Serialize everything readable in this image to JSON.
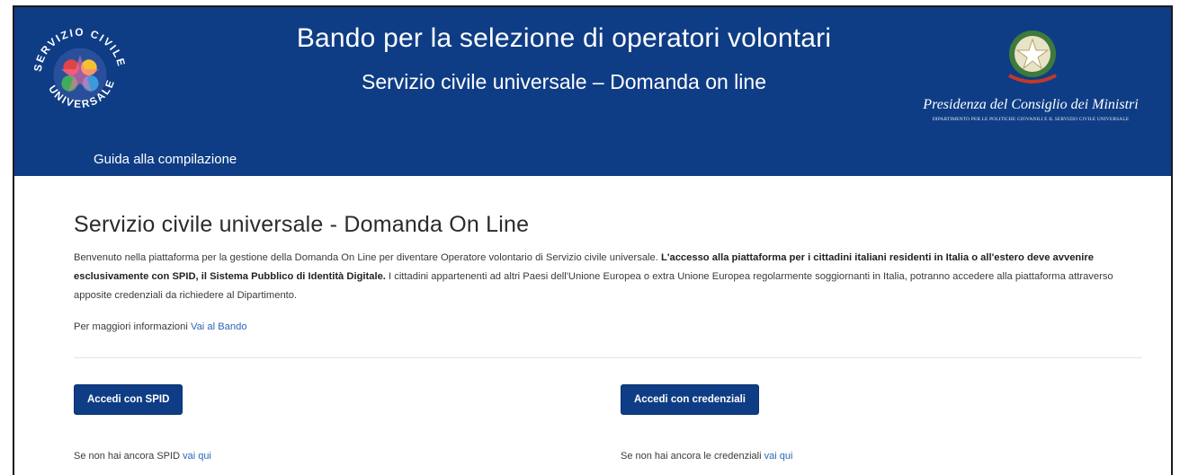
{
  "header": {
    "logo_left_text": "SERVIZIO CIVILE UNIVERSALE",
    "title": "Bando per la selezione di operatori volontari",
    "subtitle": "Servizio civile universale – Domanda on line",
    "gov_name": "Presidenza del Consiglio dei Ministri",
    "gov_dept": "DIPARTIMENTO PER LE POLITICHE GIOVANILI E IL SERVIZIO CIVILE UNIVERSALE",
    "nav_guide": "Guida alla compilazione"
  },
  "main": {
    "page_title": "Servizio civile universale - Domanda On Line",
    "intro_part1": "Benvenuto nella piattaforma per la gestione della Domanda On Line per diventare Operatore volontario di Servizio civile universale. ",
    "intro_bold": "L'accesso alla piattaforma per i cittadini italiani residenti in Italia o all'estero deve avvenire esclusivamente con SPID, il Sistema Pubblico di Identità Digitale.",
    "intro_part2": " I cittadini appartenenti ad altri Paesi dell'Unione Europea o extra Unione Europea regolarmente soggiornanti in Italia, potranno accedere alla piattaforma attraverso apposite credenziali da richiedere al Dipartimento.",
    "more_info_label": "Per maggiori informazioni ",
    "more_info_link": "Vai al Bando"
  },
  "actions": {
    "spid_button": "Accedi con SPID",
    "spid_hint": "Se non hai ancora SPID ",
    "spid_hint_link": "vai qui",
    "cred_button": "Accedi con credenziali",
    "cred_hint": "Se non hai ancora le credenziali ",
    "cred_hint_link": "vai qui"
  },
  "colors": {
    "header_bg": "#0f3d85",
    "link": "#2c66b8",
    "button_bg": "#0f3d85"
  }
}
